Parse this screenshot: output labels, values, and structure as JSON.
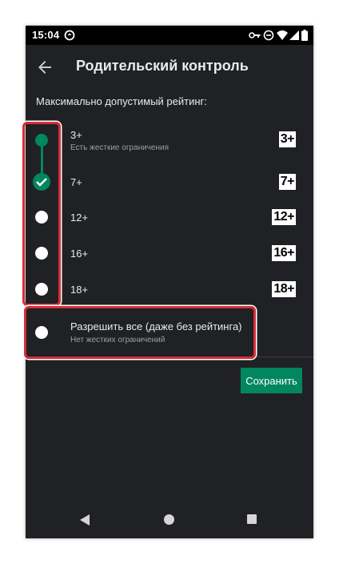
{
  "status_bar": {
    "time": "15:04",
    "icons": [
      "sync-icon",
      "key-icon",
      "do-not-disturb-icon",
      "wifi-icon",
      "signal-icon",
      "battery-icon"
    ]
  },
  "app_bar": {
    "title": "Родительский контроль",
    "back_icon": "arrow-left-icon"
  },
  "content": {
    "subheader": "Максимально допустимый рейтинг:",
    "ratings": [
      {
        "label": "3+",
        "sublabel": "Есть жесткие ограничения",
        "badge": "3+",
        "state": "included"
      },
      {
        "label": "7+",
        "sublabel": "",
        "badge": "7+",
        "state": "selected"
      },
      {
        "label": "12+",
        "sublabel": "",
        "badge": "12+",
        "state": "unselected"
      },
      {
        "label": "16+",
        "sublabel": "",
        "badge": "16+",
        "state": "unselected"
      },
      {
        "label": "18+",
        "sublabel": "",
        "badge": "18+",
        "state": "unselected"
      }
    ],
    "allow_all": {
      "label": "Разрешить все (даже без рейтинга)",
      "sublabel": "Нет жестких ограничений",
      "state": "unselected"
    },
    "save_label": "Сохранить"
  },
  "nav_bar": {
    "icons": [
      "back-triangle-icon",
      "home-circle-icon",
      "recents-square-icon"
    ]
  },
  "colors": {
    "background": "#202124",
    "accent": "#01875f",
    "text_primary": "#e8eaed",
    "text_secondary": "#9aa0a6",
    "highlight": "#d72d35"
  }
}
